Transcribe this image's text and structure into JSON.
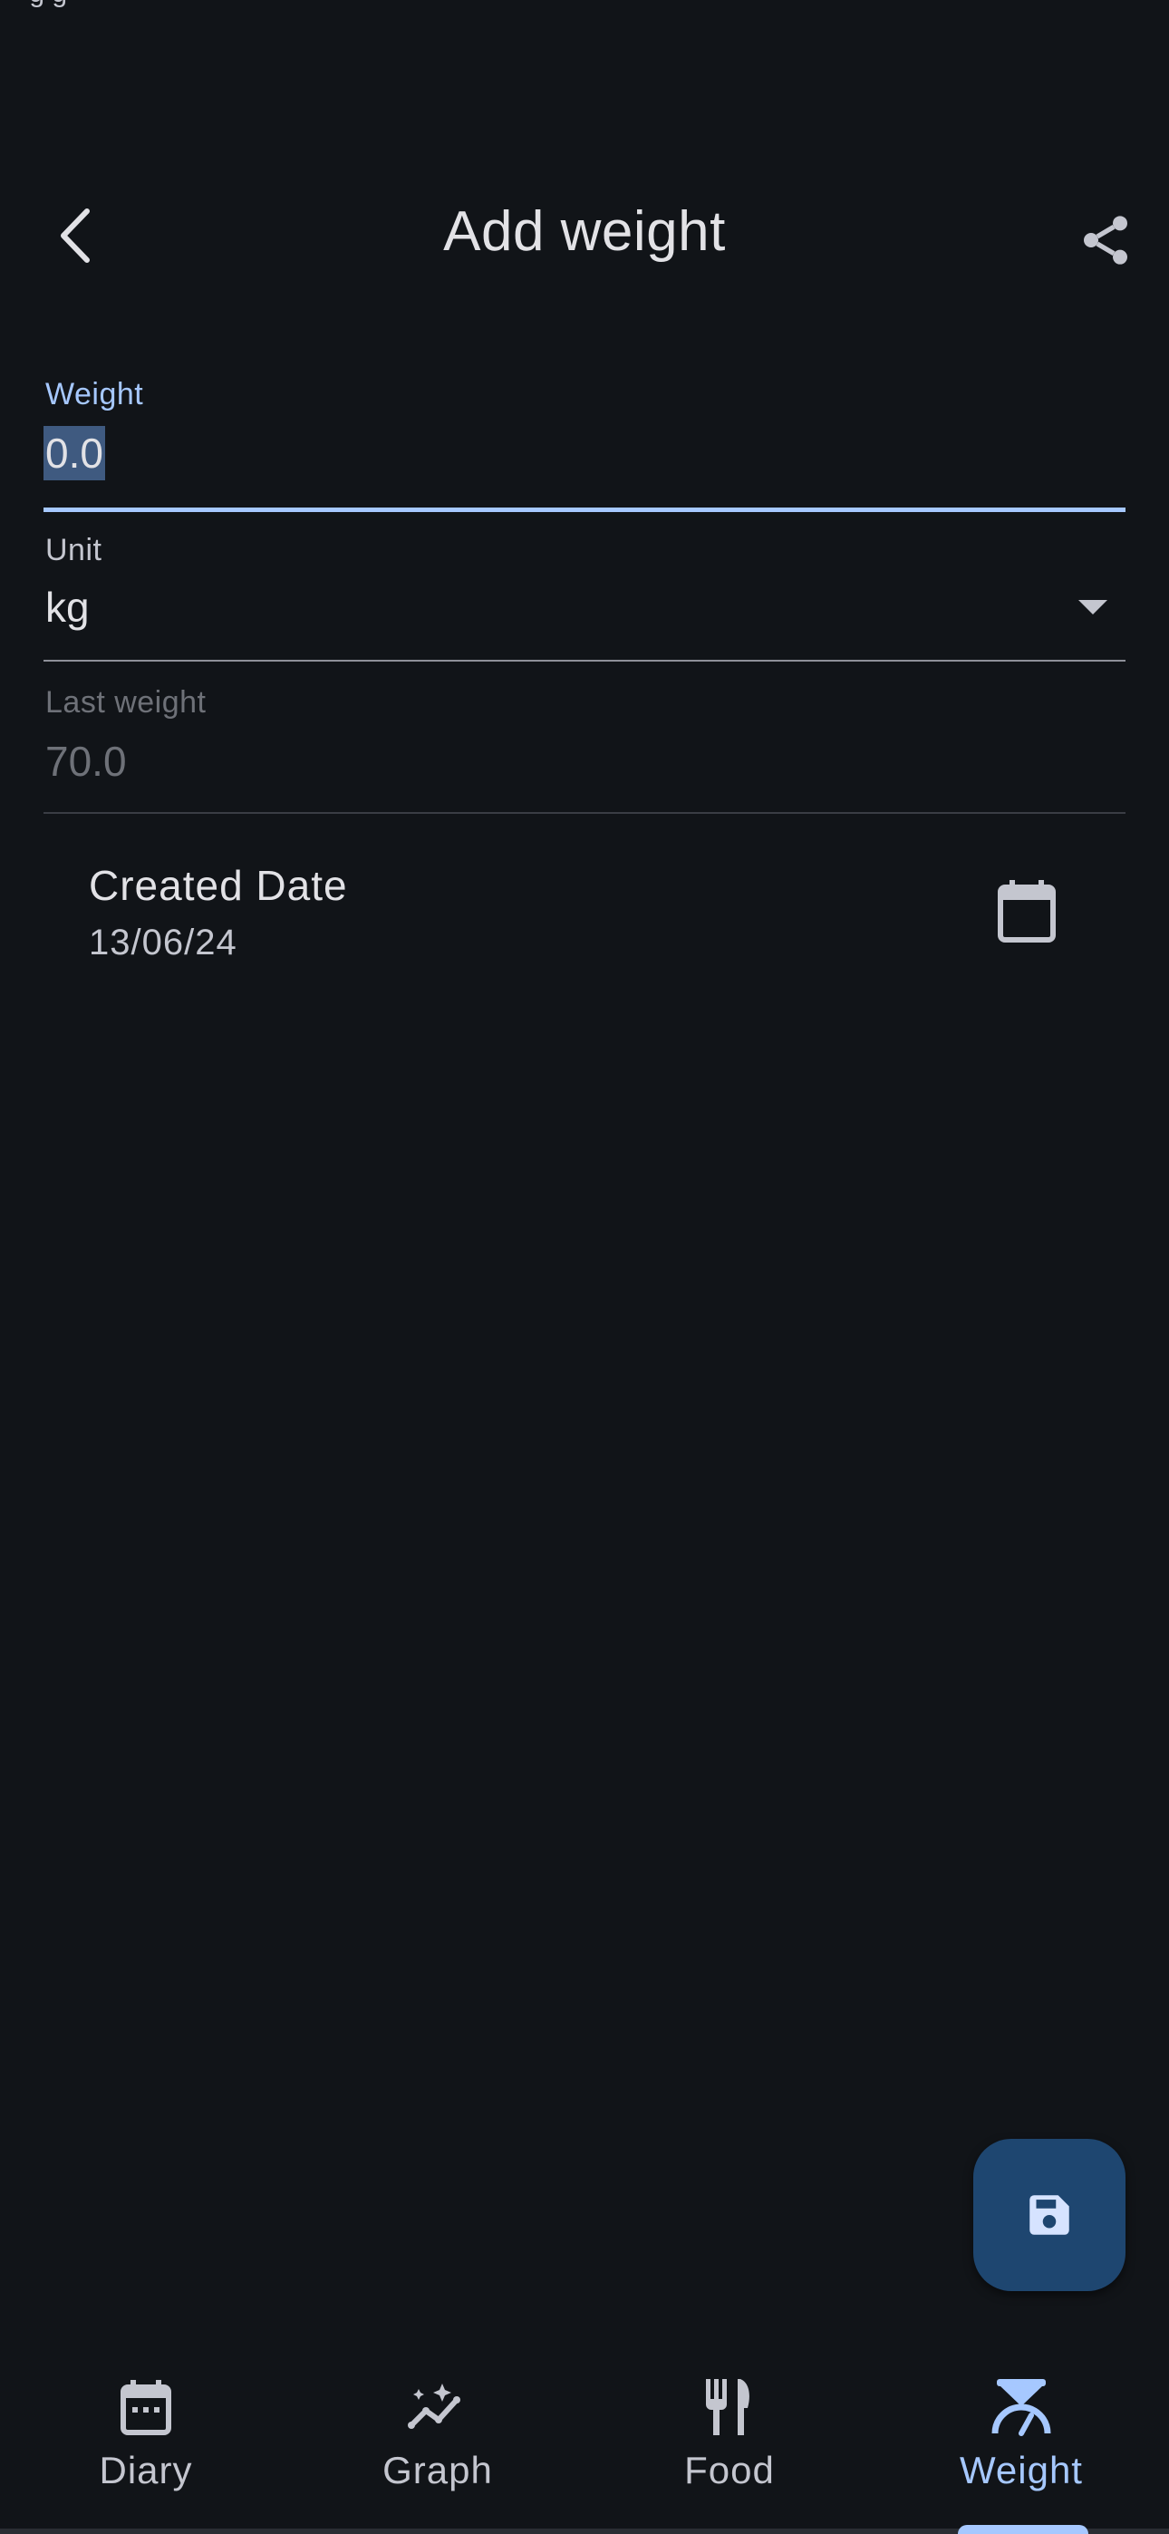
{
  "status_bar": {
    "text": "· g  g"
  },
  "header": {
    "title": "Add weight"
  },
  "fields": {
    "weight": {
      "label": "Weight",
      "value": "0.0"
    },
    "unit": {
      "label": "Unit",
      "value": "kg"
    },
    "last_weight": {
      "label": "Last weight",
      "value": "70.0"
    }
  },
  "created_date": {
    "label": "Created Date",
    "value": "13/06/24"
  },
  "nav": {
    "items": [
      {
        "label": "Diary",
        "icon": "calendar-icon"
      },
      {
        "label": "Graph",
        "icon": "graph-icon"
      },
      {
        "label": "Food",
        "icon": "fork-knife-icon"
      },
      {
        "label": "Weight",
        "icon": "scale-icon"
      }
    ],
    "active": "Weight"
  },
  "colors": {
    "background": "#111418",
    "accent": "#a6c8ff",
    "fab": "#1e4670"
  }
}
